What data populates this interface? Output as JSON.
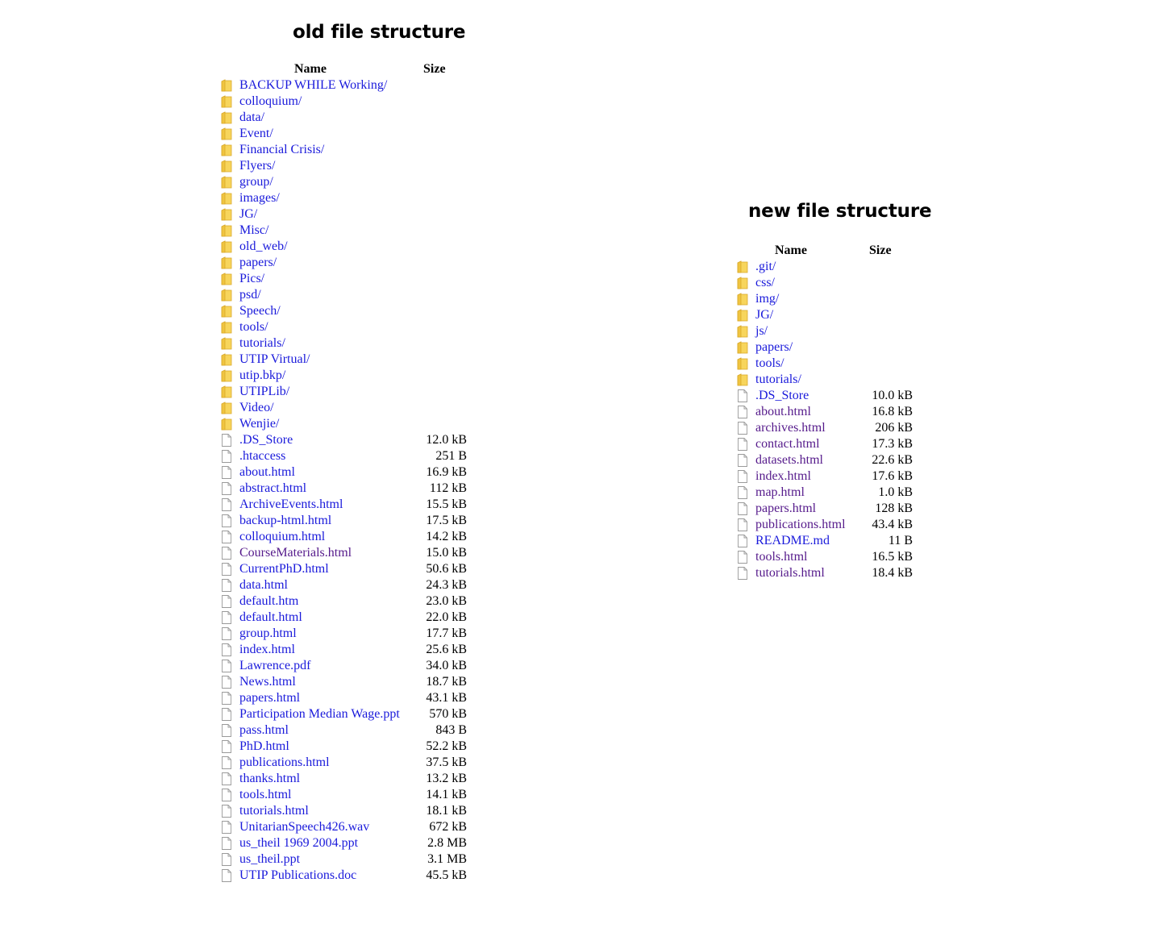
{
  "old": {
    "title": "old file structure",
    "headers": {
      "name": "Name",
      "size": "Size"
    },
    "entries": [
      {
        "type": "folder",
        "name": "BACKUP WHILE Working/",
        "size": "",
        "visited": false
      },
      {
        "type": "folder",
        "name": "colloquium/",
        "size": "",
        "visited": false
      },
      {
        "type": "folder",
        "name": "data/",
        "size": "",
        "visited": false
      },
      {
        "type": "folder",
        "name": "Event/",
        "size": "",
        "visited": false
      },
      {
        "type": "folder",
        "name": "Financial Crisis/",
        "size": "",
        "visited": false
      },
      {
        "type": "folder",
        "name": "Flyers/",
        "size": "",
        "visited": false
      },
      {
        "type": "folder",
        "name": "group/",
        "size": "",
        "visited": false
      },
      {
        "type": "folder",
        "name": "images/",
        "size": "",
        "visited": false
      },
      {
        "type": "folder",
        "name": "JG/",
        "size": "",
        "visited": false
      },
      {
        "type": "folder",
        "name": "Misc/",
        "size": "",
        "visited": false
      },
      {
        "type": "folder",
        "name": "old_web/",
        "size": "",
        "visited": false
      },
      {
        "type": "folder",
        "name": "papers/",
        "size": "",
        "visited": false
      },
      {
        "type": "folder",
        "name": "Pics/",
        "size": "",
        "visited": false
      },
      {
        "type": "folder",
        "name": "psd/",
        "size": "",
        "visited": false
      },
      {
        "type": "folder",
        "name": "Speech/",
        "size": "",
        "visited": false
      },
      {
        "type": "folder",
        "name": "tools/",
        "size": "",
        "visited": false
      },
      {
        "type": "folder",
        "name": "tutorials/",
        "size": "",
        "visited": false
      },
      {
        "type": "folder",
        "name": "UTIP Virtual/",
        "size": "",
        "visited": false
      },
      {
        "type": "folder",
        "name": "utip.bkp/",
        "size": "",
        "visited": false
      },
      {
        "type": "folder",
        "name": "UTIPLib/",
        "size": "",
        "visited": false
      },
      {
        "type": "folder",
        "name": "Video/",
        "size": "",
        "visited": false
      },
      {
        "type": "folder",
        "name": "Wenjie/",
        "size": "",
        "visited": false
      },
      {
        "type": "file",
        "name": ".DS_Store",
        "size": "12.0 kB",
        "visited": false
      },
      {
        "type": "file",
        "name": ".htaccess",
        "size": "251 B",
        "visited": false
      },
      {
        "type": "file",
        "name": "about.html",
        "size": "16.9 kB",
        "visited": false
      },
      {
        "type": "file",
        "name": "abstract.html",
        "size": "112 kB",
        "visited": false
      },
      {
        "type": "file",
        "name": "ArchiveEvents.html",
        "size": "15.5 kB",
        "visited": false
      },
      {
        "type": "file",
        "name": "backup-html.html",
        "size": "17.5 kB",
        "visited": false
      },
      {
        "type": "file",
        "name": "colloquium.html",
        "size": "14.2 kB",
        "visited": false
      },
      {
        "type": "file",
        "name": "CourseMaterials.html",
        "size": "15.0 kB",
        "visited": true
      },
      {
        "type": "file",
        "name": "CurrentPhD.html",
        "size": "50.6 kB",
        "visited": false
      },
      {
        "type": "file",
        "name": "data.html",
        "size": "24.3 kB",
        "visited": false
      },
      {
        "type": "file",
        "name": "default.htm",
        "size": "23.0 kB",
        "visited": false
      },
      {
        "type": "file",
        "name": "default.html",
        "size": "22.0 kB",
        "visited": false
      },
      {
        "type": "file",
        "name": "group.html",
        "size": "17.7 kB",
        "visited": false
      },
      {
        "type": "file",
        "name": "index.html",
        "size": "25.6 kB",
        "visited": false
      },
      {
        "type": "file",
        "name": "Lawrence.pdf",
        "size": "34.0 kB",
        "visited": false
      },
      {
        "type": "file",
        "name": "News.html",
        "size": "18.7 kB",
        "visited": false
      },
      {
        "type": "file",
        "name": "papers.html",
        "size": "43.1 kB",
        "visited": false
      },
      {
        "type": "file",
        "name": "Participation Median Wage.ppt",
        "size": "570 kB",
        "visited": false
      },
      {
        "type": "file",
        "name": "pass.html",
        "size": "843 B",
        "visited": false
      },
      {
        "type": "file",
        "name": "PhD.html",
        "size": "52.2 kB",
        "visited": false
      },
      {
        "type": "file",
        "name": "publications.html",
        "size": "37.5 kB",
        "visited": false
      },
      {
        "type": "file",
        "name": "thanks.html",
        "size": "13.2 kB",
        "visited": false
      },
      {
        "type": "file",
        "name": "tools.html",
        "size": "14.1 kB",
        "visited": false
      },
      {
        "type": "file",
        "name": "tutorials.html",
        "size": "18.1 kB",
        "visited": false
      },
      {
        "type": "file",
        "name": "UnitarianSpeech426.wav",
        "size": "672 kB",
        "visited": false
      },
      {
        "type": "file",
        "name": "us_theil 1969 2004.ppt",
        "size": "2.8 MB",
        "visited": false
      },
      {
        "type": "file",
        "name": "us_theil.ppt",
        "size": "3.1 MB",
        "visited": false
      },
      {
        "type": "file",
        "name": "UTIP Publications.doc",
        "size": "45.5 kB",
        "visited": false
      }
    ]
  },
  "new": {
    "title": "new file structure",
    "headers": {
      "name": "Name",
      "size": "Size"
    },
    "entries": [
      {
        "type": "folder",
        "name": ".git/",
        "size": "",
        "visited": false
      },
      {
        "type": "folder",
        "name": "css/",
        "size": "",
        "visited": false
      },
      {
        "type": "folder",
        "name": "img/",
        "size": "",
        "visited": false
      },
      {
        "type": "folder",
        "name": "JG/",
        "size": "",
        "visited": false
      },
      {
        "type": "folder",
        "name": "js/",
        "size": "",
        "visited": false
      },
      {
        "type": "folder",
        "name": "papers/",
        "size": "",
        "visited": false
      },
      {
        "type": "folder",
        "name": "tools/",
        "size": "",
        "visited": false
      },
      {
        "type": "folder",
        "name": "tutorials/",
        "size": "",
        "visited": false
      },
      {
        "type": "file",
        "name": ".DS_Store",
        "size": "10.0 kB",
        "visited": false
      },
      {
        "type": "file",
        "name": "about.html",
        "size": "16.8 kB",
        "visited": true
      },
      {
        "type": "file",
        "name": "archives.html",
        "size": "206 kB",
        "visited": true
      },
      {
        "type": "file",
        "name": "contact.html",
        "size": "17.3 kB",
        "visited": true
      },
      {
        "type": "file",
        "name": "datasets.html",
        "size": "22.6 kB",
        "visited": true
      },
      {
        "type": "file",
        "name": "index.html",
        "size": "17.6 kB",
        "visited": true
      },
      {
        "type": "file",
        "name": "map.html",
        "size": "1.0 kB",
        "visited": true
      },
      {
        "type": "file",
        "name": "papers.html",
        "size": "128 kB",
        "visited": true
      },
      {
        "type": "file",
        "name": "publications.html",
        "size": "43.4 kB",
        "visited": true
      },
      {
        "type": "file",
        "name": "README.md",
        "size": "11 B",
        "visited": false
      },
      {
        "type": "file",
        "name": "tools.html",
        "size": "16.5 kB",
        "visited": true
      },
      {
        "type": "file",
        "name": "tutorials.html",
        "size": "18.4 kB",
        "visited": true
      }
    ]
  },
  "colors": {
    "link": "#1a1adb",
    "visited_link": "#551a8b",
    "folder_fill": "#f7d55c",
    "folder_edge": "#d9a92a",
    "file_edge": "#9a9a9a"
  },
  "icons": {
    "folder": "folder-icon",
    "file": "file-icon"
  }
}
